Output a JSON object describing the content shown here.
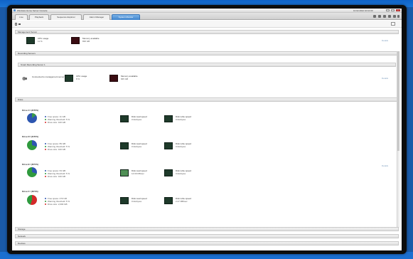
{
  "window": {
    "title": "Windows Home Server Console",
    "clock": "10.02.2012 10:10:00"
  },
  "tabs": [
    {
      "label": "Live"
    },
    {
      "label": "Playback"
    },
    {
      "label": "Sequence Explorer"
    },
    {
      "label": "Alarm Manager"
    },
    {
      "label": "System Monitor"
    }
  ],
  "sections": {
    "management_server": "Management Server",
    "recording_servers": "Recording Servers",
    "recording_server_name": "Smart Recording Server 1",
    "disks": "Disks",
    "storage": "Storage",
    "network": "Network",
    "devices": "Devices"
  },
  "management": {
    "cpu_label": "CPU usage",
    "cpu_value": "11 %",
    "memory_label": "Memory available",
    "memory_value": "836 GB",
    "details_link": "Details"
  },
  "recording": {
    "server_label": "Connected to management server",
    "cpu_label": "CPU usage",
    "cpu_value": "8 %",
    "memory_label": "Memory available",
    "memory_value": "845 GB",
    "details_link": "Details"
  },
  "disks_details_link": "Details",
  "disks": [
    {
      "name": "Drive C:\\ (NTFS)",
      "free": "Free space: 11 GB",
      "warning": "Warning threshold: 5 %",
      "total": "Drive size: 100 GB",
      "read_label": "Disk read speed",
      "read_value": "0 kilobytes",
      "write_label": "Disk write speed",
      "write_value": "0 kilobytes",
      "colors": {
        "free": "#2d56b0",
        "used": "#3a9a4a"
      }
    },
    {
      "name": "Drive D:\\ (NTFS)",
      "free": "Free space: 89 GB",
      "warning": "Warning threshold: 5 %",
      "total": "Drive size: 100 GB",
      "read_label": "Disk read speed",
      "read_value": "0 kilobytes",
      "write_label": "Disk write speed",
      "write_value": "0 kilobytes",
      "colors": {
        "free": "#2f9a3e",
        "used": "#2d56b0"
      }
    },
    {
      "name": "Drive E:\\ (NTFS)",
      "free": "Free space: 63 GB",
      "warning": "Warning threshold: 5 %",
      "total": "Drive size: 100 GB",
      "read_label": "Disk read speed",
      "read_value": "14.69 KB/sec",
      "write_label": "Disk write speed",
      "write_value": "0 kilobytes",
      "colors": {
        "free": "#2f9a3e",
        "used": "#2d56b0"
      }
    },
    {
      "name": "Drive F:\\ (NTFS)",
      "free": "Free space: 470 GB",
      "warning": "Warning threshold: 5 %",
      "total": "Drive size: 2,000 GB",
      "read_label": "Disk read speed",
      "read_value": "0 kilobytes",
      "write_label": "Disk write speed",
      "write_value": "2.27 MB/sec",
      "colors": {
        "free": "#2f9a3e",
        "used": "#d42a2a"
      }
    }
  ],
  "colors": {
    "accent": "#3e83cc",
    "dark_metric": "#1e3a2a",
    "red_metric": "#3a0c12",
    "legend_blue": "#2d56b0",
    "legend_green": "#2f9a3e",
    "legend_red": "#d42a2a"
  }
}
